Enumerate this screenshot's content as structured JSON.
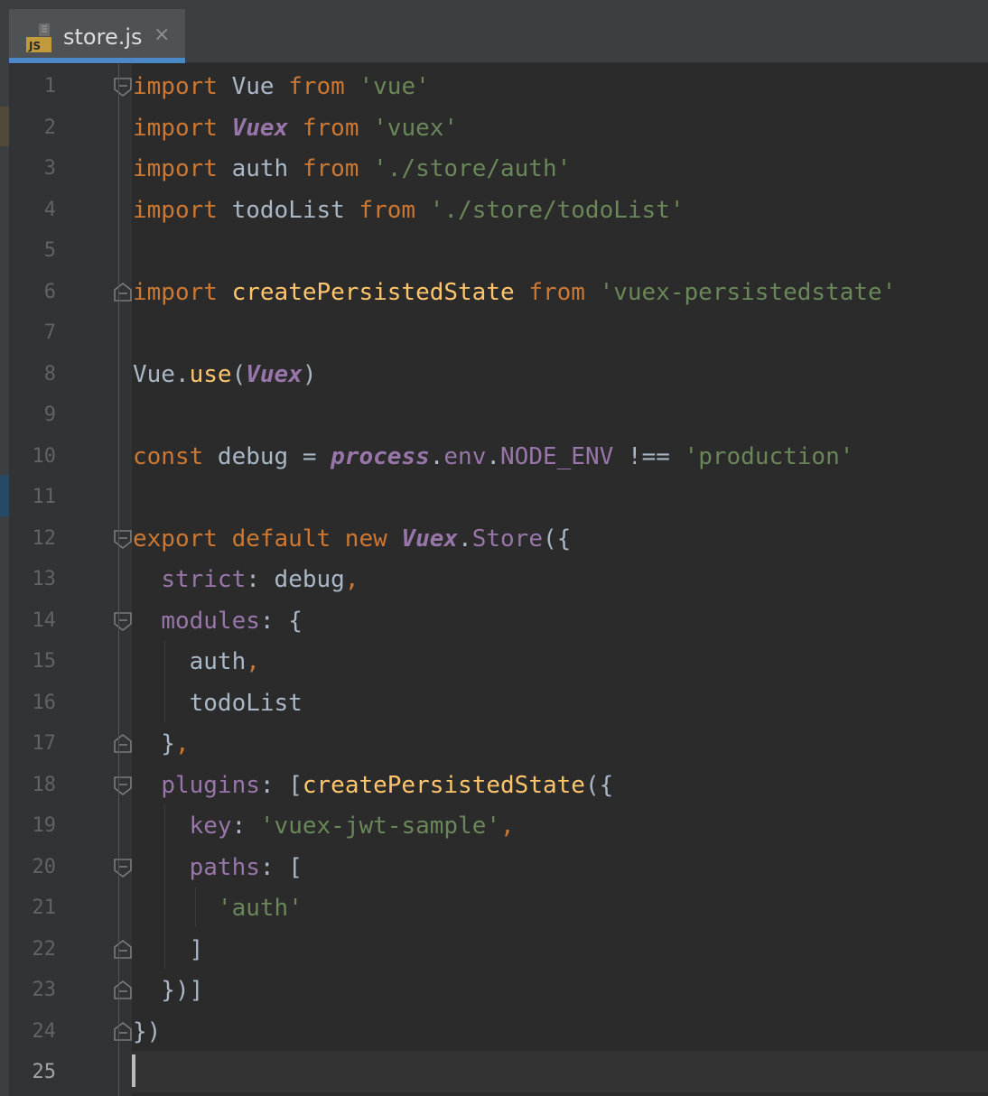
{
  "tab": {
    "label": "store.js",
    "icon": "js-file-icon",
    "close": "×"
  },
  "colors": {
    "background": "#2b2b2b",
    "keyword": "#cc7832",
    "string": "#6a8759",
    "property": "#9876aa",
    "function": "#ffc66d",
    "text": "#a9b7c6",
    "tab_underline": "#4a88c7"
  },
  "editor": {
    "current_line": 25,
    "lines": [
      {
        "n": "1",
        "fold": "open",
        "tokens": [
          {
            "t": "import",
            "c": "kw"
          },
          {
            "t": " Vue "
          },
          {
            "t": "from",
            "c": "kw"
          },
          {
            "t": " "
          },
          {
            "t": "'vue'",
            "c": "str"
          }
        ]
      },
      {
        "n": "2",
        "tokens": [
          {
            "t": "import",
            "c": "kw"
          },
          {
            "t": " "
          },
          {
            "t": "Vuex",
            "c": "cls"
          },
          {
            "t": " "
          },
          {
            "t": "from",
            "c": "kw"
          },
          {
            "t": " "
          },
          {
            "t": "'vuex'",
            "c": "str"
          }
        ]
      },
      {
        "n": "3",
        "tokens": [
          {
            "t": "import",
            "c": "kw"
          },
          {
            "t": " auth "
          },
          {
            "t": "from",
            "c": "kw"
          },
          {
            "t": " "
          },
          {
            "t": "'./store/auth'",
            "c": "str"
          }
        ]
      },
      {
        "n": "4",
        "tokens": [
          {
            "t": "import",
            "c": "kw"
          },
          {
            "t": " todoList "
          },
          {
            "t": "from",
            "c": "kw"
          },
          {
            "t": " "
          },
          {
            "t": "'./store/todoList'",
            "c": "str"
          }
        ]
      },
      {
        "n": "5",
        "tokens": []
      },
      {
        "n": "6",
        "fold": "close",
        "tokens": [
          {
            "t": "import",
            "c": "kw"
          },
          {
            "t": " "
          },
          {
            "t": "createPersistedState",
            "c": "fn"
          },
          {
            "t": " "
          },
          {
            "t": "from",
            "c": "kw"
          },
          {
            "t": " "
          },
          {
            "t": "'vuex-persistedstate'",
            "c": "str"
          }
        ]
      },
      {
        "n": "7",
        "tokens": []
      },
      {
        "n": "8",
        "tokens": [
          {
            "t": "Vue."
          },
          {
            "t": "use",
            "c": "fn"
          },
          {
            "t": "("
          },
          {
            "t": "Vuex",
            "c": "cls"
          },
          {
            "t": ")"
          }
        ]
      },
      {
        "n": "9",
        "tokens": []
      },
      {
        "n": "10",
        "tokens": [
          {
            "t": "const",
            "c": "kw"
          },
          {
            "t": " debug = "
          },
          {
            "t": "process",
            "c": "cls"
          },
          {
            "t": "."
          },
          {
            "t": "env",
            "c": "prop"
          },
          {
            "t": "."
          },
          {
            "t": "NODE_ENV",
            "c": "prop"
          },
          {
            "t": " !== "
          },
          {
            "t": "'production'",
            "c": "str"
          }
        ]
      },
      {
        "n": "11",
        "tokens": []
      },
      {
        "n": "12",
        "fold": "open",
        "tokens": [
          {
            "t": "export default new",
            "c": "kw"
          },
          {
            "t": " "
          },
          {
            "t": "Vuex",
            "c": "cls"
          },
          {
            "t": "."
          },
          {
            "t": "Store",
            "c": "prop"
          },
          {
            "t": "({"
          }
        ]
      },
      {
        "n": "13",
        "tokens": [
          {
            "t": "  "
          },
          {
            "t": "strict",
            "c": "prop"
          },
          {
            "t": ": debug"
          },
          {
            "t": ",",
            "c": "kw"
          }
        ]
      },
      {
        "n": "14",
        "fold": "open",
        "tokens": [
          {
            "t": "  "
          },
          {
            "t": "modules",
            "c": "prop"
          },
          {
            "t": ": {"
          }
        ]
      },
      {
        "n": "15",
        "tokens": [
          {
            "t": "    auth"
          },
          {
            "t": ",",
            "c": "kw"
          }
        ]
      },
      {
        "n": "16",
        "tokens": [
          {
            "t": "    todoList"
          }
        ]
      },
      {
        "n": "17",
        "fold": "close",
        "tokens": [
          {
            "t": "  }"
          },
          {
            "t": ",",
            "c": "kw"
          }
        ]
      },
      {
        "n": "18",
        "fold": "open",
        "tokens": [
          {
            "t": "  "
          },
          {
            "t": "plugins",
            "c": "prop"
          },
          {
            "t": ": ["
          },
          {
            "t": "createPersistedState",
            "c": "fn"
          },
          {
            "t": "({"
          }
        ]
      },
      {
        "n": "19",
        "tokens": [
          {
            "t": "    "
          },
          {
            "t": "key",
            "c": "prop"
          },
          {
            "t": ": "
          },
          {
            "t": "'vuex-jwt-sample'",
            "c": "str"
          },
          {
            "t": ",",
            "c": "kw"
          }
        ]
      },
      {
        "n": "20",
        "fold": "open",
        "tokens": [
          {
            "t": "    "
          },
          {
            "t": "paths",
            "c": "prop"
          },
          {
            "t": ": ["
          }
        ]
      },
      {
        "n": "21",
        "tokens": [
          {
            "t": "      "
          },
          {
            "t": "'auth'",
            "c": "str"
          }
        ]
      },
      {
        "n": "22",
        "fold": "close",
        "tokens": [
          {
            "t": "    ]"
          }
        ]
      },
      {
        "n": "23",
        "fold": "close",
        "tokens": [
          {
            "t": "  })]"
          }
        ]
      },
      {
        "n": "24",
        "fold": "close",
        "tokens": [
          {
            "t": "})"
          }
        ]
      },
      {
        "n": "25",
        "tokens": []
      }
    ]
  }
}
